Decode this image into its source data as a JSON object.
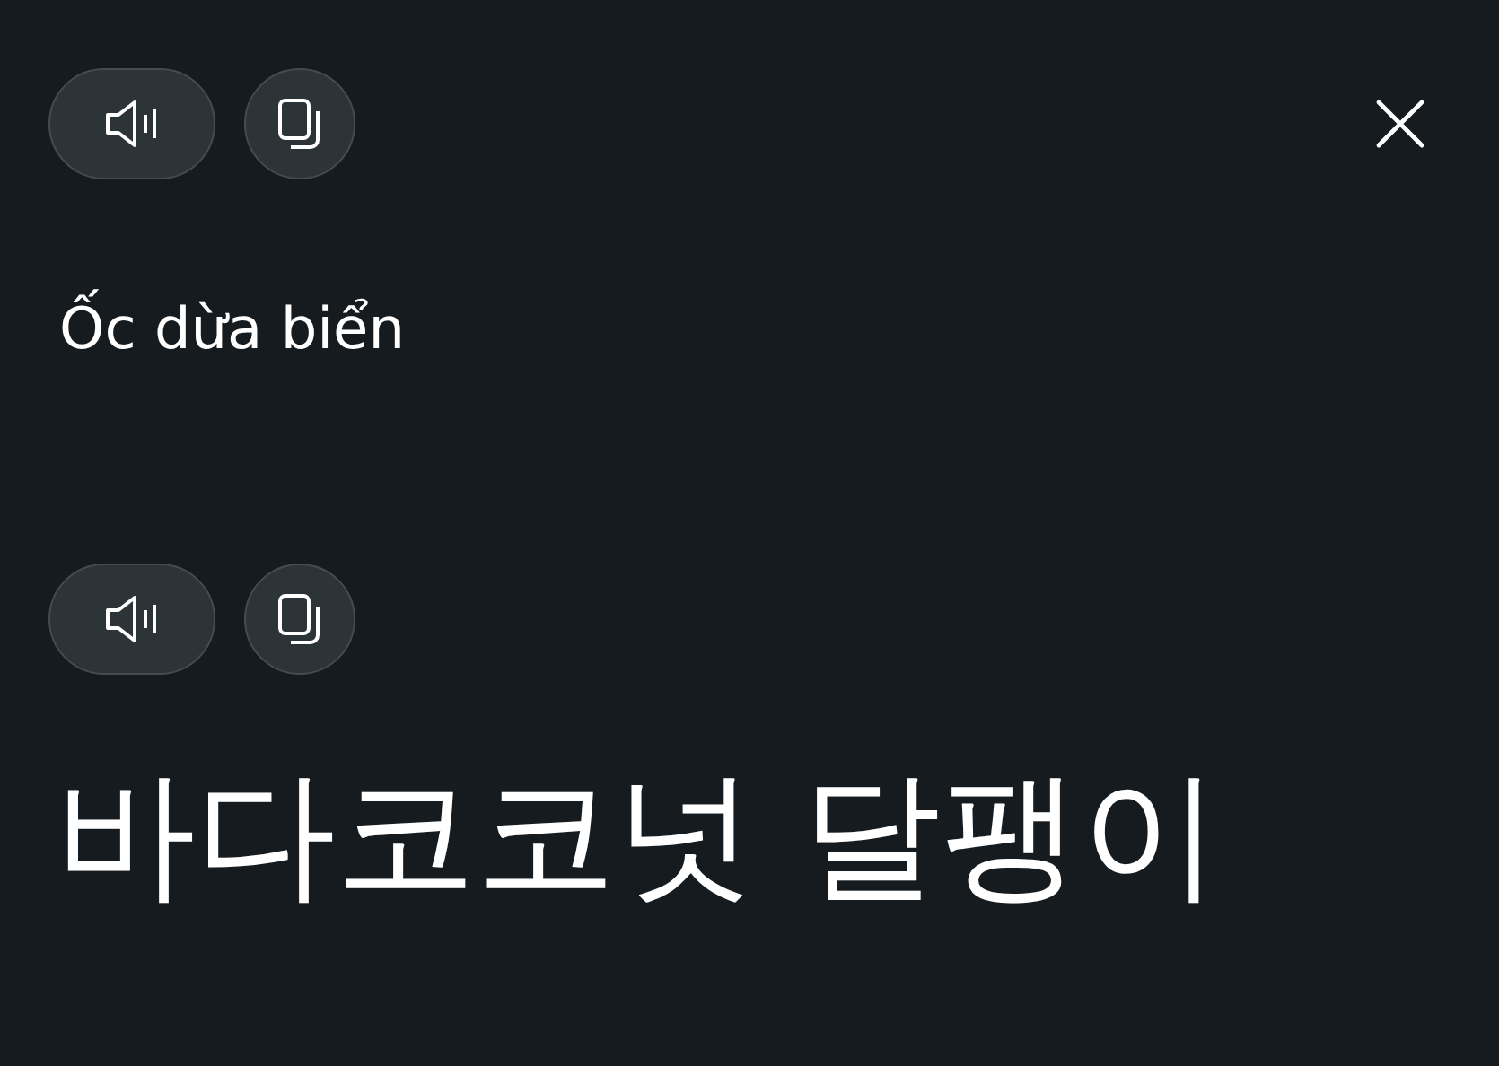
{
  "source": {
    "text": "Ốc dừa biển"
  },
  "translation": {
    "text": "바다코코넛 달팽이"
  }
}
